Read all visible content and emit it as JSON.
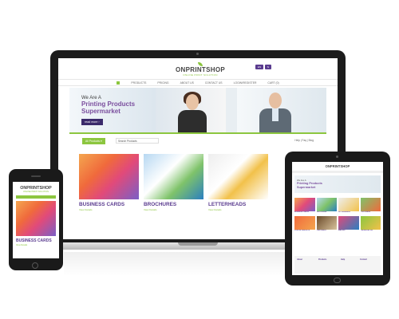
{
  "laptop": {
    "logo_text": "ONPRINTSHOP",
    "logo_tagline": "ONLINE PRINT SOLUTION",
    "lang_selector": "EN",
    "currency_selector": "$",
    "nav": [
      "PRODUCTS",
      "PRICING",
      "ABOUT US",
      "CONTACT US",
      "LOGIN/REGISTER",
      "CART (0)"
    ],
    "hero_line1": "We Are A",
    "hero_line2": "Printing Products",
    "hero_line3": "Supermarket",
    "hero_button": "read more ›",
    "all_products_button": "All Products ▾",
    "search_placeholder": "Search Products",
    "help_links": "Help | Faq | Blog",
    "cards": [
      {
        "title": "BUSINESS CARDS",
        "sub": "View Details"
      },
      {
        "title": "BROCHURES",
        "sub": "View Details"
      },
      {
        "title": "LETTERHEADS",
        "sub": "View Details"
      }
    ]
  },
  "phone": {
    "logo_text": "ONPRINTSHOP",
    "logo_tagline": "ONLINE PRINT SOLUTION",
    "card_title": "BUSINESS CARDS",
    "card_sub": "View Details"
  },
  "tablet": {
    "logo_text": "ONPRINTSHOP",
    "hero_line1": "We Are A",
    "hero_line2": "Printing Products",
    "hero_line3": "Supermarket",
    "tiles": [
      "BUSINESS CARDS",
      "BROCHURES",
      "LETTERHEADS",
      "POSTCARDS",
      "POSTER LEAFLETS",
      "STATIONERY",
      "MAILING",
      "PRESENTATION"
    ],
    "footer": [
      "About",
      "Products",
      "Help",
      "Contact"
    ]
  },
  "colors": {
    "brand_purple": "#5a3b8f",
    "brand_green": "#8cc63f"
  }
}
